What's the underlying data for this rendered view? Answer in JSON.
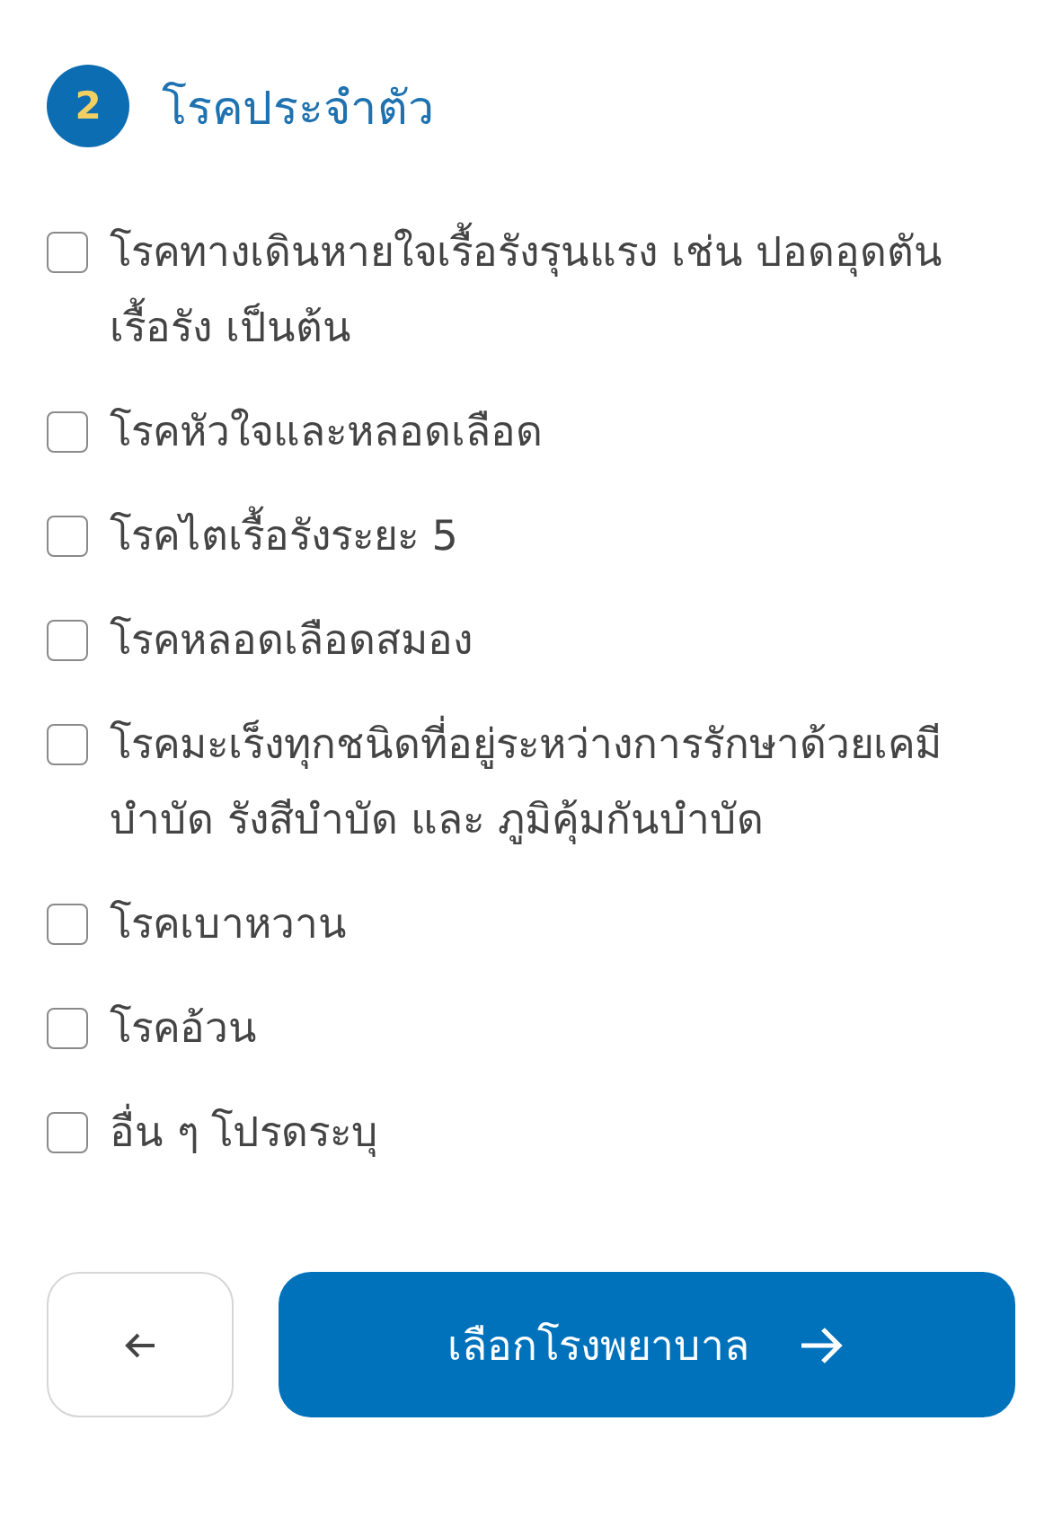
{
  "section": {
    "number": "2",
    "title": "โรคประจำตัว"
  },
  "options": [
    {
      "label": "โรคทางเดินหายใจเรื้อรังรุนแรง เช่น ปอดอุดตันเรื้อรัง เป็นต้น",
      "checked": false
    },
    {
      "label": "โรคหัวใจและหลอดเลือด",
      "checked": false
    },
    {
      "label": "โรคไตเรื้อรังระยะ 5",
      "checked": false
    },
    {
      "label": "โรคหลอดเลือดสมอง",
      "checked": false
    },
    {
      "label": "โรคมะเร็งทุกชนิดที่อยู่ระหว่างการรักษาด้วยเคมีบำบัด รังสีบำบัด และ ภูมิคุ้มกันบำบัด",
      "checked": false
    },
    {
      "label": "โรคเบาหวาน",
      "checked": false
    },
    {
      "label": "โรคอ้วน",
      "checked": false
    },
    {
      "label": "อื่น ๆ โปรดระบุ",
      "checked": false
    }
  ],
  "next_button": {
    "label": "เลือกโรงพยาบาล"
  }
}
